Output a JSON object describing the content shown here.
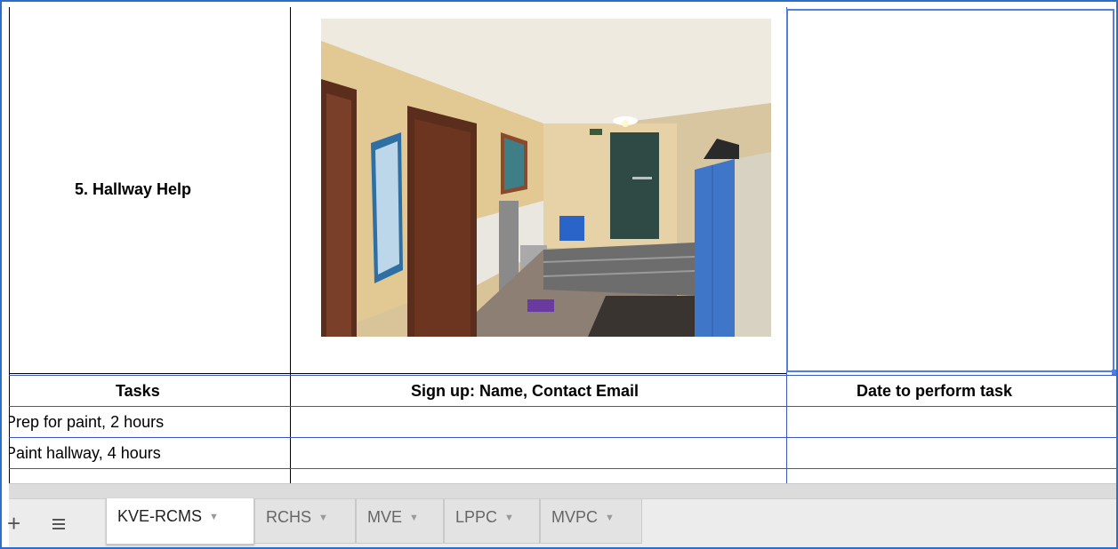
{
  "sheet": {
    "section_title": "5. Hallway Help",
    "headers": {
      "tasks": "Tasks",
      "signup": "Sign up: Name, Contact Email",
      "date": "Date to perform task"
    },
    "rows": [
      {
        "task": "Prep for paint, 2 hours",
        "signup": "",
        "date": ""
      },
      {
        "task": "Paint hallway, 4 hours",
        "signup": "",
        "date": ""
      }
    ],
    "photo_icon": "hallway-photo"
  },
  "tabbar": {
    "add_icon": "plus-icon",
    "all_sheets_icon": "hamburger-icon",
    "tabs": [
      {
        "label": "KVE-RCMS",
        "active": true
      },
      {
        "label": "RCHS",
        "active": false
      },
      {
        "label": "MVE",
        "active": false
      },
      {
        "label": "LPPC",
        "active": false
      },
      {
        "label": "MVPC",
        "active": false
      }
    ],
    "tab_menu_glyph": "▼"
  },
  "colors": {
    "frame_border": "#2b6fc6",
    "grid_blue": "#3b56c7",
    "selection": "#4f80de"
  }
}
